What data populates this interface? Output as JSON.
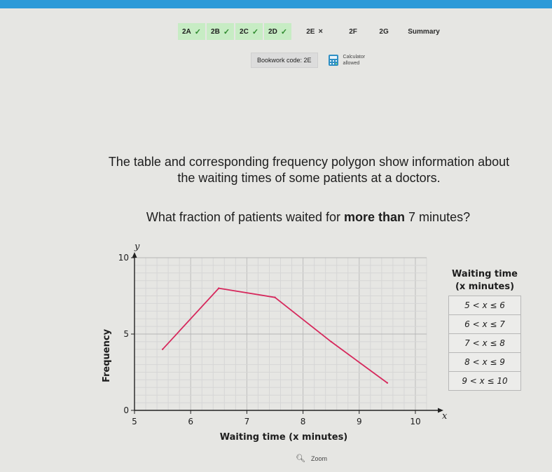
{
  "tabs": [
    {
      "label": "2A",
      "status": "✓"
    },
    {
      "label": "2B",
      "status": "✓"
    },
    {
      "label": "2C",
      "status": "✓"
    },
    {
      "label": "2D",
      "status": "✓"
    },
    {
      "label": "2E",
      "status": "×"
    },
    {
      "label": "2F",
      "status": ""
    },
    {
      "label": "2G",
      "status": ""
    },
    {
      "label": "Summary",
      "status": ""
    }
  ],
  "bookwork": {
    "label": "Bookwork code: 2E",
    "calculator_line1": "Calculator",
    "calculator_line2": "allowed",
    "calculator_icon": "calculator-icon"
  },
  "question": {
    "line1": "The table and corresponding frequency polygon show information about",
    "line2": "the waiting times of some patients at a doctors.",
    "ask_prefix": "What fraction of patients waited for ",
    "ask_bold": "more than",
    "ask_suffix": " 7 minutes?"
  },
  "chart_data": {
    "type": "line",
    "ylabel": "Frequency",
    "xlabel": "Waiting time (x minutes)",
    "y_axis_symbol": "y",
    "x_axis_symbol": "x",
    "xlim": [
      5,
      10.2
    ],
    "ylim": [
      0,
      10
    ],
    "x_ticks": [
      5,
      6,
      7,
      8,
      9,
      10
    ],
    "y_ticks": [
      0,
      5,
      10
    ],
    "grid": true,
    "series_color": "#d6285c",
    "points": [
      {
        "x": 5.5,
        "y": 4
      },
      {
        "x": 6.5,
        "y": 8
      },
      {
        "x": 7.5,
        "y": 7.4
      },
      {
        "x": 8.5,
        "y": 4.5
      },
      {
        "x": 9.5,
        "y": 1.8
      }
    ]
  },
  "table": {
    "header_line1": "Waiting time",
    "header_line2": "(x minutes)",
    "rows": [
      "5 < x ≤ 6",
      "6 < x ≤ 7",
      "7 < x ≤ 8",
      "8 < x ≤ 9",
      "9 < x ≤ 10"
    ]
  },
  "zoom": {
    "label": "Zoom",
    "icon": "search-icon"
  }
}
